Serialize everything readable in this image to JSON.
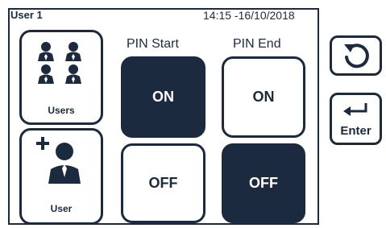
{
  "header": {
    "user": "User 1",
    "datetime": "14:15 -16/10/2018"
  },
  "tiles": {
    "users_label": "Users",
    "user_label": "User",
    "users_icon": "group-icon",
    "user_icon": "add-user-icon"
  },
  "columns": {
    "pin_start": "PIN Start",
    "pin_end": "PIN End"
  },
  "pin_start": {
    "on_label": "ON",
    "off_label": "OFF",
    "selected": "ON"
  },
  "pin_end": {
    "on_label": "ON",
    "off_label": "OFF",
    "selected": "OFF"
  },
  "sidebar": {
    "back_icon": "back-icon",
    "enter_icon": "enter-arrow-icon",
    "enter_label": "Enter"
  },
  "colors": {
    "primary": "#1b2a3f",
    "background": "#ffffff"
  }
}
